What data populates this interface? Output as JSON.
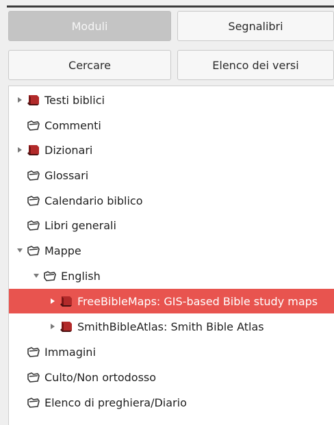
{
  "tabs": {
    "moduli": "Moduli",
    "segnalibri": "Segnalibri",
    "cercare": "Cercare",
    "elenco_versi": "Elenco dei versi"
  },
  "tree": {
    "items": [
      {
        "label": "Testi biblici",
        "icon": "book-icon",
        "expander": "collapsed"
      },
      {
        "label": "Commenti",
        "icon": "folder-icon",
        "expander": "none"
      },
      {
        "label": "Dizionari",
        "icon": "book-icon",
        "expander": "collapsed"
      },
      {
        "label": "Glossari",
        "icon": "folder-icon",
        "expander": "none"
      },
      {
        "label": "Calendario biblico",
        "icon": "folder-icon",
        "expander": "none"
      },
      {
        "label": "Libri generali",
        "icon": "folder-icon",
        "expander": "none"
      },
      {
        "label": "Mappe",
        "icon": "folder-icon",
        "expander": "expanded"
      },
      {
        "label": "English",
        "icon": "folder-icon",
        "expander": "expanded"
      },
      {
        "label": "FreeBibleMaps: GIS-based Bible study maps",
        "icon": "book-icon",
        "expander": "collapsed",
        "selected": true
      },
      {
        "label": "SmithBibleAtlas: Smith Bible Atlas",
        "icon": "book-icon",
        "expander": "collapsed"
      },
      {
        "label": "Immagini",
        "icon": "folder-icon",
        "expander": "none"
      },
      {
        "label": "Culto/Non ortodosso",
        "icon": "folder-icon",
        "expander": "none"
      },
      {
        "label": "Elenco di preghiera/Diario",
        "icon": "folder-icon",
        "expander": "none"
      }
    ]
  },
  "colors": {
    "selection": "#e8544f",
    "book": "#b22a2a",
    "active_tab": "#c4c4c4"
  }
}
